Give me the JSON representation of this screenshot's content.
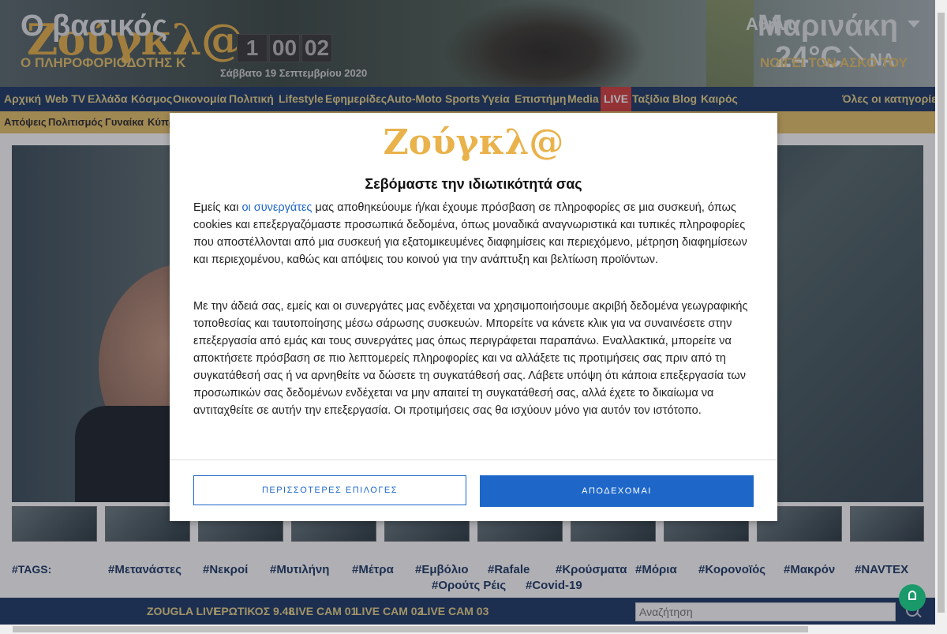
{
  "header": {
    "logo": "Ζούγκλ@",
    "clock": [
      "1",
      "00",
      "02"
    ],
    "date": "Σάββατο 19 Σεπτεμβρίου 2020",
    "weather": {
      "city": "Αθήνα",
      "temp": "24°C",
      "wind": "ΝΑ"
    }
  },
  "nav": {
    "items": [
      "Αρχική",
      "Web TV",
      "Ελλάδα",
      "Κόσμος",
      "Οικονομία",
      "Πολιτική",
      "Lifestyle",
      "Εφημερίδες",
      "Auto-Moto",
      "Sports",
      "Υγεία",
      "Επιστήμη",
      "Media",
      "LIVE",
      "Ταξίδια",
      "Blog",
      "Καιρός"
    ],
    "all_categories": "Όλες οι κατηγορίες"
  },
  "subnav": {
    "items": [
      "Απόψεις",
      "Πολιτισμός",
      "Γυναίκα",
      "Κύπρ"
    ]
  },
  "hero": {
    "title_left": "Ο βασικός",
    "title_right": "Μαρινάκη",
    "subtitle_left": "Ο ΠΛΗΡΟΦΟΡΙΟΔΟΤΗΣ Κ",
    "subtitle_right": "ΝΟΙΓΕΙ ΤΟΝ ΑΣΚΟ ΤΟΥ"
  },
  "tags": {
    "label": "#TAGS:",
    "items": [
      "#Μετανάστες",
      "#Νεκροί",
      "#Μυτιλήνη",
      "#Μέτρα",
      "#Εμβόλιο",
      "#Rafale",
      "#Κρούσματα",
      "#Μόρια",
      "#Κορονοϊός",
      "#Μακρόν",
      "#NAVTEX",
      "#Ορούτς Ρέις",
      "#Covid-19"
    ]
  },
  "bottombar": {
    "links": [
      "ZOUGLA LIVE",
      "ΕΡΩΤΙΚΟΣ 9.48",
      "LIVE CAM 01",
      "LIVE CAM 02",
      "LIVE CAM 03"
    ],
    "search_placeholder": "Αναζήτηση"
  },
  "consent": {
    "logo": "Ζούγκλ@",
    "title": "Σεβόμαστε την ιδιωτικότητά σας",
    "p1_before": "Εμείς και ",
    "p1_link": "οι συνεργάτες",
    "p1_after": " μας αποθηκεύουμε ή/και έχουμε πρόσβαση σε πληροφορίες σε μια συσκευή, όπως cookies και επεξεργαζόμαστε προσωπικά δεδομένα, όπως μοναδικά αναγνωριστικά και τυπικές πληροφορίες που αποστέλλονται από μια συσκευή για εξατομικευμένες διαφημίσεις και περιεχόμενο, μέτρηση διαφημίσεων και περιεχομένου, καθώς και απόψεις του κοινού για την ανάπτυξη και βελτίωση προϊόντων.",
    "p2": "Με την άδειά σας, εμείς και οι συνεργάτες μας ενδέχεται να χρησιμοποιήσουμε ακριβή δεδομένα γεωγραφικής τοποθεσίας και ταυτοποίησης μέσω σάρωσης συσκευών. Μπορείτε να κάνετε κλικ για να συναινέσετε στην επεξεργασία από εμάς και τους συνεργάτες μας όπως περιγράφεται παραπάνω. Εναλλακτικά, μπορείτε να αποκτήσετε πρόσβαση σε πιο λεπτομερείς πληροφορίες και να αλλάξετε τις προτιμήσεις σας πριν από τη συγκατάθεσή σας ή να αρνηθείτε να δώσετε τη συγκατάθεσή σας. Λάβετε υπόψη ότι κάποια επεξεργασία των προσωπικών σας δεδομένων ενδέχεται να μην απαιτεί τη συγκατάθεσή σας, αλλά έχετε το δικαίωμα να αντιταχθείτε σε αυτήν την επεξεργασία. Οι προτιμήσεις σας θα ισχύουν μόνο για αυτόν τον ιστότοπο.",
    "btn_more": "ΠΕΡΙΣΣΟΤΕΡΕΣ ΕΠΙΛΟΓΕΣ",
    "btn_accept": "ΑΠΟΔΕΧΟΜΑΙ"
  },
  "colors": {
    "brand": "#e9b24a",
    "nav_bg": "#1e3a66",
    "nav_text": "#e8d48a",
    "accent_blue": "#1e67c9",
    "live_red": "#d43e3e"
  }
}
